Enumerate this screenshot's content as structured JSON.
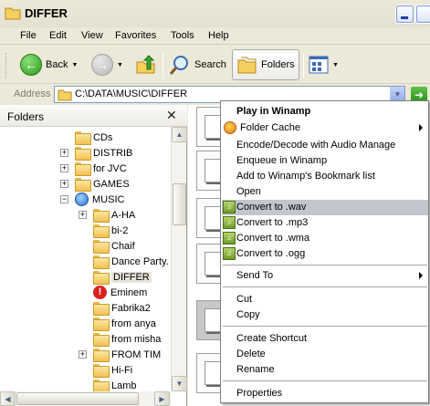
{
  "window": {
    "title": "DIFFER"
  },
  "menubar": {
    "items": [
      "File",
      "Edit",
      "View",
      "Favorites",
      "Tools",
      "Help"
    ]
  },
  "toolbar": {
    "back_label": "Back",
    "search_label": "Search",
    "folders_label": "Folders"
  },
  "address": {
    "label": "Address",
    "value": "C:\\DATA\\MUSIC\\DIFFER"
  },
  "folders_pane": {
    "title": "Folders",
    "tree": [
      {
        "label": "CDs",
        "expander": ""
      },
      {
        "label": "DISTRIB",
        "expander": "+"
      },
      {
        "label": "for JVC",
        "expander": "+"
      },
      {
        "label": "GAMES",
        "expander": "+"
      },
      {
        "label": "MUSIC",
        "expander": "−"
      },
      {
        "label": "A-HA",
        "expander": "+"
      },
      {
        "label": "bi-2",
        "expander": ""
      },
      {
        "label": "Chaif",
        "expander": ""
      },
      {
        "label": "Dance Party.",
        "expander": ""
      },
      {
        "label": "DIFFER",
        "expander": "",
        "selected": true
      },
      {
        "label": "Eminem",
        "expander": ""
      },
      {
        "label": "Fabrika2",
        "expander": ""
      },
      {
        "label": "from anya",
        "expander": ""
      },
      {
        "label": "from misha",
        "expander": ""
      },
      {
        "label": "FROM TIM",
        "expander": "+"
      },
      {
        "label": "Hi-Fi",
        "expander": ""
      },
      {
        "label": "Lamb",
        "expander": ""
      }
    ]
  },
  "context_menu": {
    "items": [
      {
        "label": "Play in Winamp",
        "bold": true
      },
      {
        "label": "Folder Cache",
        "submenu": true,
        "icon": "folder-cache-icon"
      },
      {
        "label": "Encode/Decode with Audio Manage"
      },
      {
        "label": "Enqueue in Winamp"
      },
      {
        "label": "Add to Winamp's Bookmark list"
      },
      {
        "label": "Open"
      },
      {
        "label": "Convert to .wav",
        "icon": "winamp-convert-icon",
        "highlighted": true
      },
      {
        "label": "Convert to .mp3",
        "icon": "winamp-convert-icon"
      },
      {
        "label": "Convert to .wma",
        "icon": "winamp-convert-icon"
      },
      {
        "label": "Convert to .ogg",
        "icon": "winamp-convert-icon"
      },
      {
        "label": "Send To",
        "submenu": true
      },
      {
        "label": "Cut"
      },
      {
        "label": "Copy"
      },
      {
        "label": "Create Shortcut"
      },
      {
        "label": "Delete"
      },
      {
        "label": "Rename"
      },
      {
        "label": "Properties"
      }
    ]
  }
}
